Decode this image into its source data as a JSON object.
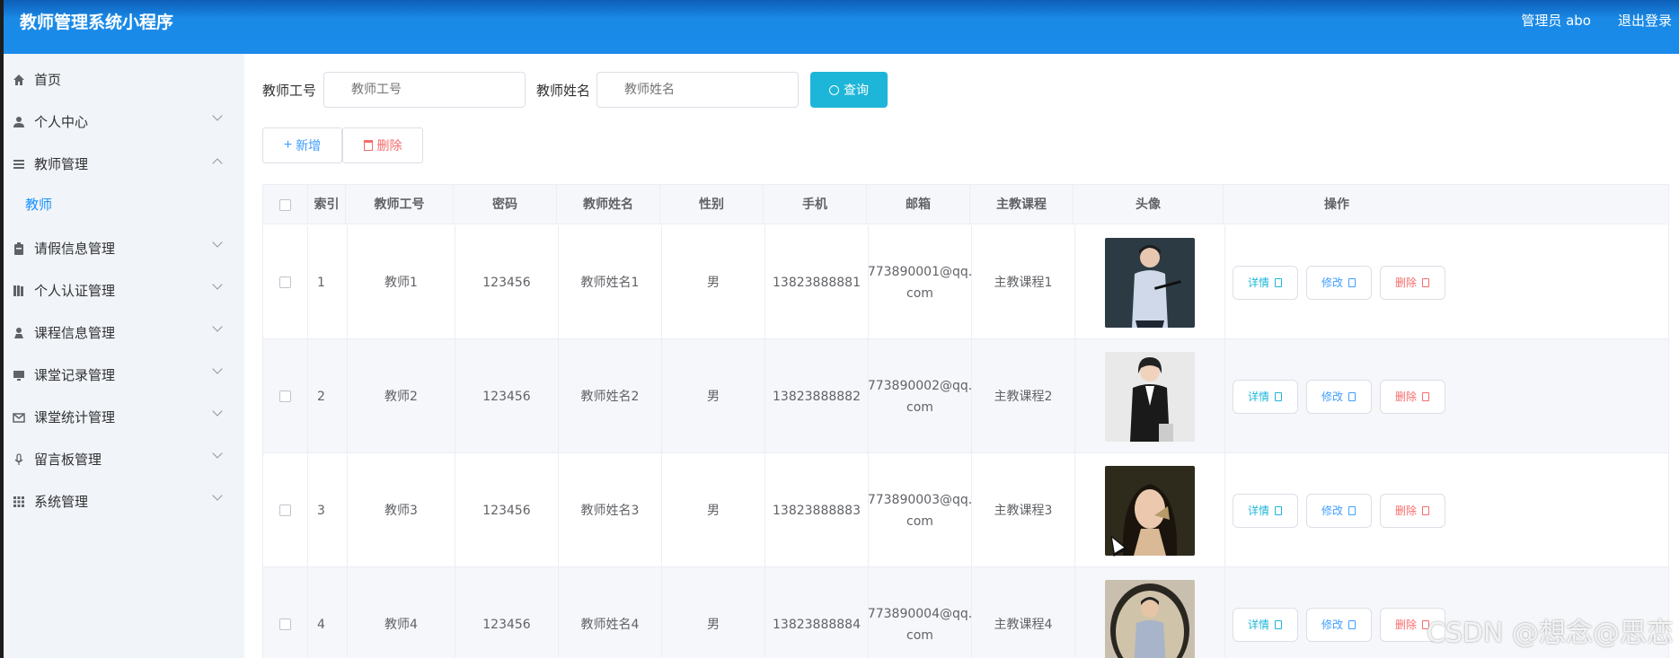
{
  "app": {
    "title": "教师管理系统小程序",
    "admin_label": "管理员 abo",
    "logout_label": "退出登录"
  },
  "sidebar": {
    "items": [
      {
        "label": "首页",
        "icon": "home-icon",
        "arrow": "none"
      },
      {
        "label": "个人中心",
        "icon": "user-icon",
        "arrow": "down"
      },
      {
        "label": "教师管理",
        "icon": "list-icon",
        "arrow": "up"
      },
      {
        "label": "教师",
        "sub": true
      },
      {
        "label": "请假信息管理",
        "icon": "clipboard-icon",
        "arrow": "down"
      },
      {
        "label": "个人认证管理",
        "icon": "book-icon",
        "arrow": "down"
      },
      {
        "label": "课程信息管理",
        "icon": "person-icon",
        "arrow": "down"
      },
      {
        "label": "课堂记录管理",
        "icon": "monitor-icon",
        "arrow": "down"
      },
      {
        "label": "课堂统计管理",
        "icon": "mail-icon",
        "arrow": "down"
      },
      {
        "label": "留言板管理",
        "icon": "mic-icon",
        "arrow": "down"
      },
      {
        "label": "系统管理",
        "icon": "grid-icon",
        "arrow": "down"
      }
    ]
  },
  "search": {
    "teacher_no_label": "教师工号",
    "teacher_no_placeholder": "教师工号",
    "teacher_name_label": "教师姓名",
    "teacher_name_placeholder": "教师姓名",
    "query_label": "查询"
  },
  "actions": {
    "add_label": "新增",
    "delete_label": "删除"
  },
  "table": {
    "headers": [
      "索引",
      "教师工号",
      "密码",
      "教师姓名",
      "性别",
      "手机",
      "邮箱",
      "主教课程",
      "头像",
      "操作"
    ],
    "rows": [
      {
        "index": "1",
        "teacher_no": "教师1",
        "password": "123456",
        "name": "教师姓名1",
        "gender": "男",
        "phone": "13823888881",
        "email_line1": "773890001@qq.",
        "email_line2": "com",
        "course": "主教课程1"
      },
      {
        "index": "2",
        "teacher_no": "教师2",
        "password": "123456",
        "name": "教师姓名2",
        "gender": "男",
        "phone": "13823888882",
        "email_line1": "773890002@qq.",
        "email_line2": "com",
        "course": "主教课程2"
      },
      {
        "index": "3",
        "teacher_no": "教师3",
        "password": "123456",
        "name": "教师姓名3",
        "gender": "男",
        "phone": "13823888883",
        "email_line1": "773890003@qq.",
        "email_line2": "com",
        "course": "主教课程3"
      },
      {
        "index": "4",
        "teacher_no": "教师4",
        "password": "123456",
        "name": "教师姓名4",
        "gender": "男",
        "phone": "13823888884",
        "email_line1": "773890004@qq.",
        "email_line2": "com",
        "course": "主教课程4"
      }
    ],
    "op_labels": {
      "detail": "详情",
      "edit": "修改",
      "remove": "删除"
    }
  },
  "watermark": "CSDN @想念@思恋",
  "colors": {
    "header": "#1b8beb",
    "accent": "#1890ff",
    "query": "#1eb6d8",
    "danger": "#f56c6c",
    "sidebar_bg": "#f1f4f8"
  }
}
